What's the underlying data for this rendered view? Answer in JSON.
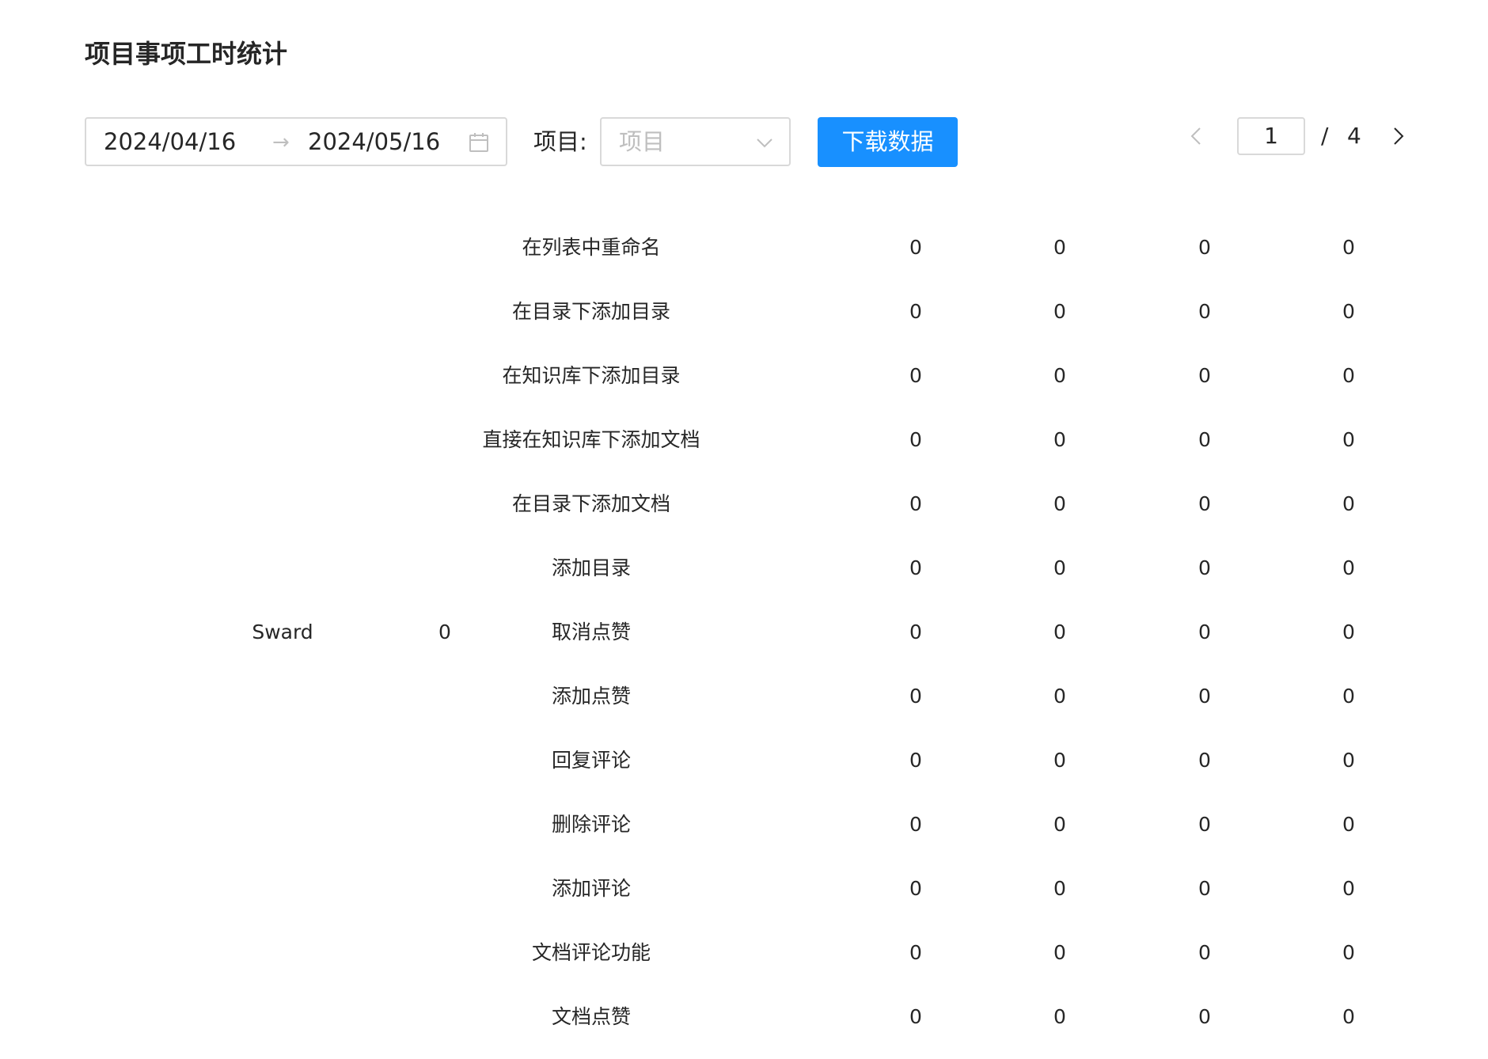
{
  "page": {
    "title": "项目事项工时统计"
  },
  "filters": {
    "date_start": "2024/04/16",
    "date_end": "2024/05/16",
    "date_separator": "→",
    "project_label": "项目:",
    "project_placeholder": "项目",
    "download_label": "下载数据"
  },
  "pagination": {
    "current": "1",
    "separator": "/",
    "total": "4"
  },
  "table": {
    "project": "Sward",
    "project_hours": "0",
    "rows": [
      {
        "name": "在列表中重命名",
        "v1": "0",
        "v2": "0",
        "v3": "0",
        "v4": "0"
      },
      {
        "name": "在目录下添加目录",
        "v1": "0",
        "v2": "0",
        "v3": "0",
        "v4": "0"
      },
      {
        "name": "在知识库下添加目录",
        "v1": "0",
        "v2": "0",
        "v3": "0",
        "v4": "0"
      },
      {
        "name": "直接在知识库下添加文档",
        "v1": "0",
        "v2": "0",
        "v3": "0",
        "v4": "0"
      },
      {
        "name": "在目录下添加文档",
        "v1": "0",
        "v2": "0",
        "v3": "0",
        "v4": "0"
      },
      {
        "name": "添加目录",
        "v1": "0",
        "v2": "0",
        "v3": "0",
        "v4": "0"
      },
      {
        "name": "取消点赞",
        "v1": "0",
        "v2": "0",
        "v3": "0",
        "v4": "0"
      },
      {
        "name": "添加点赞",
        "v1": "0",
        "v2": "0",
        "v3": "0",
        "v4": "0"
      },
      {
        "name": "回复评论",
        "v1": "0",
        "v2": "0",
        "v3": "0",
        "v4": "0"
      },
      {
        "name": "删除评论",
        "v1": "0",
        "v2": "0",
        "v3": "0",
        "v4": "0"
      },
      {
        "name": "添加评论",
        "v1": "0",
        "v2": "0",
        "v3": "0",
        "v4": "0"
      },
      {
        "name": "文档评论功能",
        "v1": "0",
        "v2": "0",
        "v3": "0",
        "v4": "0"
      },
      {
        "name": "文档点赞",
        "v1": "0",
        "v2": "0",
        "v3": "0",
        "v4": "0"
      }
    ]
  },
  "colors": {
    "primary": "#1890ff",
    "border": "#d9d9d9",
    "placeholder": "#bfbfbf",
    "text": "#262626"
  }
}
